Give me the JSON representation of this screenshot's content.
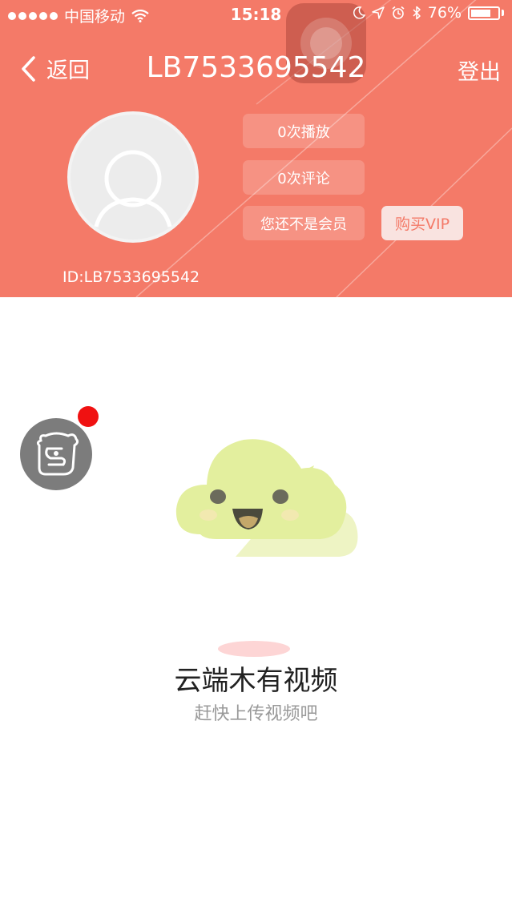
{
  "status_bar": {
    "carrier": "中国移动",
    "time": "15:18",
    "battery_text": "76%",
    "battery_level": 0.76,
    "icons": [
      "signal-dots-icon",
      "wifi-icon",
      "moon-icon",
      "location-icon",
      "alarm-icon",
      "bluetooth-icon",
      "battery-icon"
    ]
  },
  "nav": {
    "back_label": "返回",
    "title": "LB7533695542",
    "logout_label": "登出"
  },
  "profile": {
    "id_text": "ID:LB7533695542",
    "plays": "0次播放",
    "comments": "0次评论",
    "membership": "您还不是会员",
    "vip_button": "购买VIP"
  },
  "empty_state": {
    "title": "云端木有视频",
    "subtitle": "赶快上传视频吧"
  },
  "colors": {
    "header_bg": "#f47a68",
    "accent_text": "#f47a68",
    "badge_red": "#f01111",
    "cloud_green": "#e3ef9e"
  }
}
